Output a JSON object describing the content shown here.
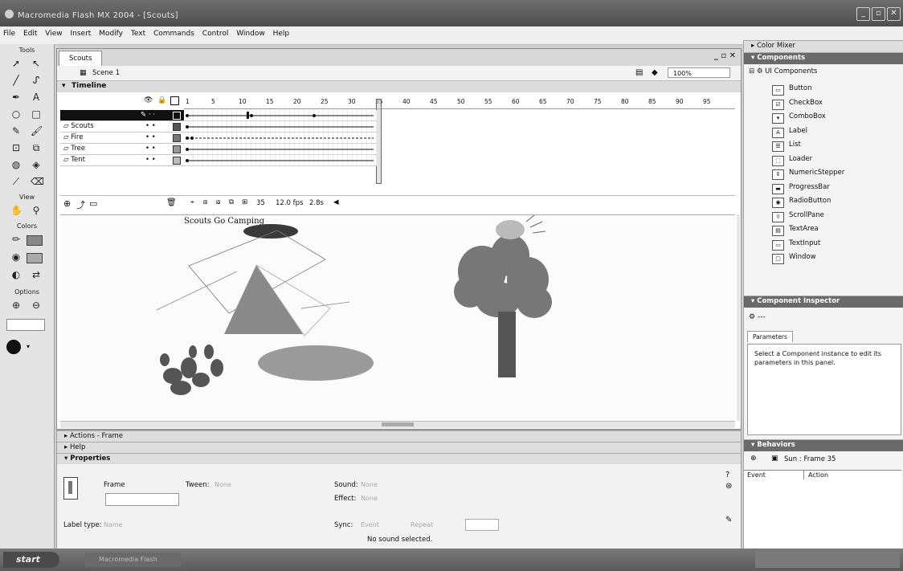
{
  "window": {
    "title": "Macromedia Flash MX 2004 - [Scouts]"
  },
  "menu": [
    "File",
    "Edit",
    "View",
    "Insert",
    "Modify",
    "Text",
    "Commands",
    "Control",
    "Window",
    "Help"
  ],
  "tools": {
    "title": "Tools",
    "view_label": "View",
    "colors_label": "Colors",
    "options_label": "Options"
  },
  "document": {
    "tab": "Scouts",
    "scene": "Scene 1",
    "zoom": "100%",
    "timeline_label": "Timeline",
    "layers": [
      "",
      "Scouts",
      "Fire",
      "Tree",
      "Tent"
    ],
    "frame_numbers": [
      "1",
      "5",
      "10",
      "15",
      "20",
      "25",
      "30",
      "35",
      "40",
      "45",
      "50",
      "55",
      "60",
      "65",
      "70",
      "75",
      "80",
      "85",
      "90",
      "95"
    ],
    "status": {
      "frame": "35",
      "fps": "12.0 fps",
      "time": "2.8s"
    },
    "stage_text": "Scouts Go Camping"
  },
  "bottom_panels": {
    "actions": "Actions - Frame",
    "help": "Help",
    "properties": "Properties",
    "frame_label": "Frame",
    "tween_label": "Tween:",
    "tween_value": "None",
    "sound_label": "Sound:",
    "sound_value": "None",
    "effect_label": "Effect:",
    "effect_value": "None",
    "sync_label": "Sync:",
    "sync_value": "Event",
    "repeat_value": "Repeat",
    "label_type": "Label type:",
    "label_type_value": "Name",
    "no_sound": "No sound selected."
  },
  "right_panels": {
    "color_mixer": "Color Mixer",
    "components": "Components",
    "ui_components": "UI Components",
    "items": [
      "Button",
      "CheckBox",
      "ComboBox",
      "Label",
      "List",
      "Loader",
      "NumericStepper",
      "ProgressBar",
      "RadioButton",
      "ScrollPane",
      "TextArea",
      "TextInput",
      "Window"
    ],
    "inspector": "Component Inspector",
    "inspector_sel": "---",
    "parameters_tab": "Parameters",
    "inspector_msg": "Select a Component instance to edit its parameters in this panel.",
    "behaviors": "Behaviors",
    "behaviors_target": "Sun : Frame 35",
    "col_event": "Event",
    "col_action": "Action"
  },
  "taskbar": {
    "start": "start",
    "task": "Macromedia Flash"
  }
}
